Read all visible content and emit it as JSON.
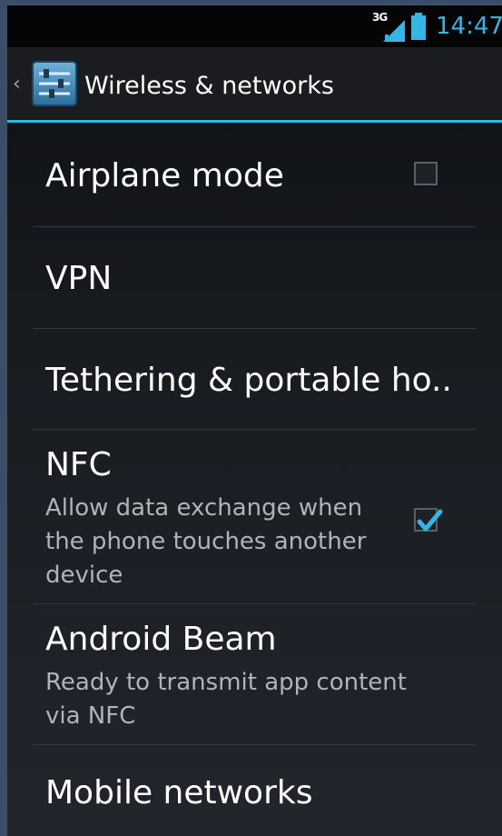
{
  "status_bar": {
    "network_type": "3G",
    "time": "14:47",
    "icons": [
      "signal-icon",
      "battery-icon"
    ]
  },
  "action_bar": {
    "title": "Wireless & networks",
    "icons": [
      "up-caret-icon",
      "settings-sliders-icon"
    ]
  },
  "settings": {
    "airplane_mode": {
      "title": "Airplane mode",
      "checked": false
    },
    "vpn": {
      "title": "VPN"
    },
    "tethering": {
      "title": "Tethering & portable ho.."
    },
    "nfc": {
      "title": "NFC",
      "summary_lines": [
        "Allow data exchange when",
        "the phone touches another",
        "device"
      ],
      "checked": true
    },
    "android_beam": {
      "title": "Android Beam",
      "summary_lines": [
        "Ready to transmit app content",
        "via NFC"
      ]
    },
    "mobile_networks": {
      "title": "Mobile networks"
    }
  },
  "colors": {
    "accent": "#33b5e5",
    "text_primary": "#ffffff",
    "text_secondary": "#b0b4b8",
    "divider": "#34383e"
  }
}
